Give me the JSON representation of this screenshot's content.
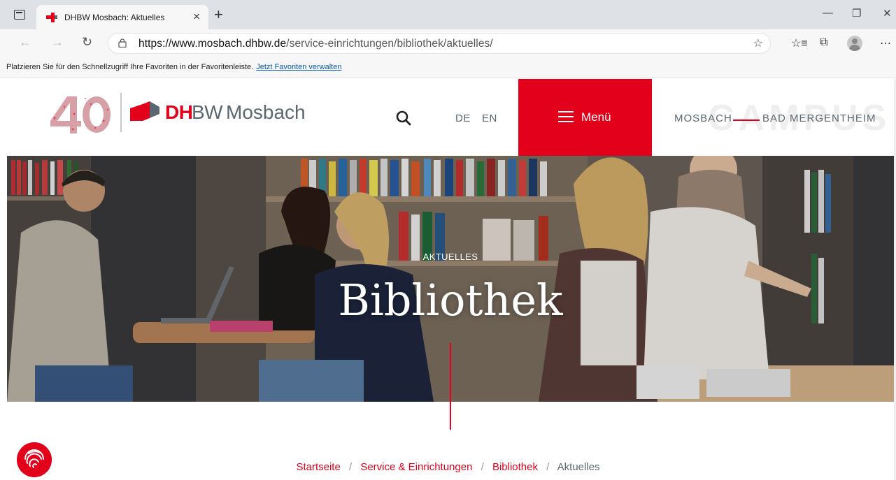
{
  "browser": {
    "tab_title": "DHBW Mosbach: Aktuelles",
    "tab_close": "×",
    "new_tab": "+",
    "url_host": "https://www.mosbach.dhbw.de",
    "url_path": "/service-einrichtungen/bibliothek/aktuelles/",
    "favbar_text": "Platzieren Sie für den Schnellzugriff Ihre Favoriten in der Favoritenleiste.",
    "favbar_link": "Jetzt Favoriten verwalten",
    "icons": [
      "sidebar-icon",
      "back-icon",
      "forward-icon",
      "reload-icon",
      "lock-icon",
      "add-favorite-icon",
      "favorites-icon",
      "collections-icon",
      "profile-icon",
      "more-icon",
      "minimize-icon",
      "restore-icon",
      "close-icon"
    ]
  },
  "header": {
    "logo_dh": "DH",
    "logo_bw": "BW",
    "logo_city": "Mosbach",
    "lang_de": "DE",
    "lang_en": "EN",
    "menu_label": "Menü",
    "campus_watermark": "CAMPUS",
    "campus_a": "MOSBACH",
    "campus_b": "BAD MERGENTHEIM"
  },
  "hero": {
    "kicker": "AKTUELLES",
    "title": "Bibliothek"
  },
  "breadcrumb": {
    "items": [
      "Startseite",
      "Service & Einrichtungen",
      "Bibliothek"
    ],
    "separator": "/",
    "current": "Aktuelles"
  },
  "colors": {
    "brand_red": "#e2001a",
    "brand_grey": "#5b6770"
  }
}
